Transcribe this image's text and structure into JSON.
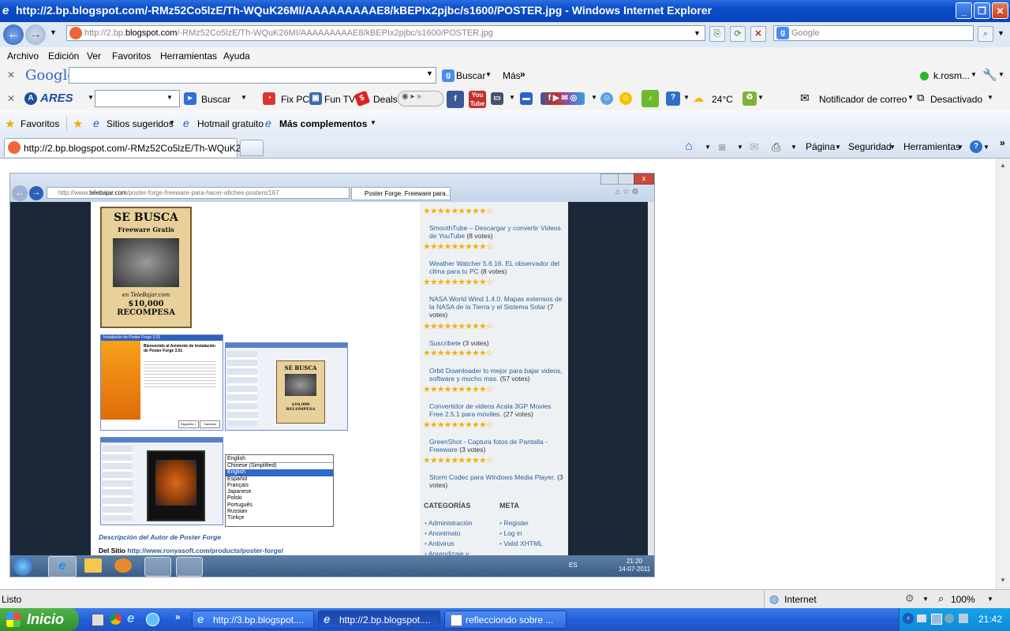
{
  "window": {
    "title": "http://2.bp.blogspot.com/-RMz52Co5lzE/Th-WQuK26MI/AAAAAAAAAE8/kBEPIx2pjbc/s1600/POSTER.jpg - Windows Internet Explorer"
  },
  "address_bar": {
    "prefix": "http://2.bp.",
    "domain": "blogspot.com",
    "suffix": "/-RMz52Co5lzE/Th-WQuK26MI/AAAAAAAAAE8/kBEPIx2pjbc/s1600/POSTER.jpg",
    "search_placeholder": "Google"
  },
  "menu": [
    "Archivo",
    "Edición",
    "Ver",
    "Favoritos",
    "Herramientas",
    "Ayuda"
  ],
  "google_toolbar": {
    "logo": "Google",
    "search_label": "Buscar",
    "more_label": "Más",
    "user": "k.rosm..."
  },
  "ares_toolbar": {
    "logo": "ARES",
    "search_label": "Buscar",
    "fixpc": "Fix PC",
    "funtv": "Fun TV",
    "deals": "Deals",
    "weather": "24°C",
    "mail_notifier": "Notificador de correo",
    "mail_status": "Desactivado"
  },
  "favorites_bar": {
    "favorites": "Favoritos",
    "suggested": "Sitios sugeridos",
    "hotmail": "Hotmail gratuito",
    "addons": "Más complementos"
  },
  "tab": {
    "title": "http://2.bp.blogspot.com/-RMz52Co5lzE/Th-WQuK26...",
    "page_menu": "Página",
    "security_menu": "Seguridad",
    "tools_menu": "Herramientas"
  },
  "inner_browser": {
    "url": "http://www.telebajar.com/poster-forge-freeware-para-hacer-afiches-posters/167",
    "url_prefix": "http://www.",
    "url_domain": "telebajar.com",
    "url_rest": "/poster-forge-freeware-para-hacer-afiches-posters/167",
    "tab": "Poster Forge. Freeware para...",
    "poster": {
      "title": "SE BUSCA",
      "subtitle": "Freeware Gratis",
      "footer": "en TeleBajar.com",
      "reward": "$10,000 RECOMPESA"
    },
    "installer": {
      "title": "Instalación de Poster Forge 3.01",
      "heading": "Bienvenido al Asistente de Instalación de Poster Forge 3.01",
      "next": "Siguiente >",
      "cancel": "Cancelar"
    },
    "language_select": {
      "selected": "English",
      "options": [
        "Chinese (Simplified)",
        "English",
        "Español",
        "Français",
        "Japanese",
        "Polski",
        "Português",
        "Russian",
        "Türkçe"
      ]
    },
    "author_link": "Descripción del Autor de Poster Forge",
    "site_label": "Del Sitio",
    "site_url": "http://www.ronyasoft.com/products/poster-forge/",
    "sidebar_items": [
      {
        "title": "SmoothTube – Descargar y convertir Videos de YouTube",
        "votes": "(8 votes)"
      },
      {
        "title": "Weather Watcher 5.6.16. EL observador del clima para tu PC",
        "votes": "(8 votes)"
      },
      {
        "title": "NASA World Wind 1.4.0. Mapas extensos de la NASA de la Tierra y el Sistema Solar",
        "votes": "(7 votes)"
      },
      {
        "title": "Suscribete",
        "votes": "(3 votes)"
      },
      {
        "title": "Orbit Downloader lo mejor para bajar videos, software y mucho mas.",
        "votes": "(57 votes)"
      },
      {
        "title": "Convertidor de videos Acala 3GP Movies Free 2.5.1 para móviles.",
        "votes": "(27 votes)"
      },
      {
        "title": "GreenShot - Captura fotos de Pantalla - Freeware",
        "votes": "(3 votes)"
      },
      {
        "title": "Storm Codec para Windows Media Player.",
        "votes": "(3 votes)"
      }
    ],
    "categories_heading": "CATEGORÍAS",
    "meta_heading": "META",
    "categories": [
      "Administración",
      "Anonimato",
      "Antivirus",
      "Aprendizaje y"
    ],
    "meta": [
      "Register",
      "Log in",
      "Valid XHTML"
    ],
    "tray_lang": "ES",
    "tray_time": "21:20",
    "tray_date": "14-07-2011"
  },
  "status_bar": {
    "text": "Listo",
    "zone": "Internet",
    "zoom": "100%"
  },
  "taskbar": {
    "start": "Inicio",
    "tasks": [
      "http://3.bp.blogspot....",
      "http://2.bp.blogspot....",
      "reflecciondo sobre ..."
    ],
    "clock": "21:42"
  }
}
